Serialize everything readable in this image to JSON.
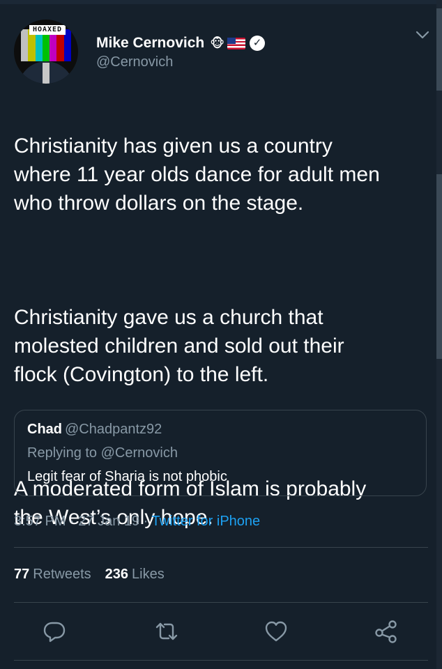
{
  "tweet": {
    "author": {
      "display_name": "Mike Cernovich",
      "handle": "@Cernovich",
      "avatar_label": "HOAXED",
      "emoji_1": "🐵",
      "verified_glyph": "✓"
    },
    "paragraph_1": "Christianity has given us a country\nwhere 11 year olds dance for adult men\nwho throw dollars on the stage.",
    "paragraph_2": "Christianity gave us a church that\nmolested children and sold out their\nflock (Covington) to the left.",
    "paragraph_3": "A moderated form of Islam is probably\nthe West’s only hope.",
    "quoted": {
      "name": "Chad",
      "handle": "@Chadpantz92",
      "replying_to": "Replying to @Cernovich",
      "body": "Legit fear of Sharia is not phobic"
    },
    "time": "3:57 PM",
    "date": "27 Jan 19",
    "separator": " · ",
    "source": "Twitter for iPhone",
    "retweets_count": "77",
    "retweets_label": "Retweets",
    "likes_count": "236",
    "likes_label": "Likes"
  },
  "icons": {
    "more": "chevron-down-icon",
    "reply": "reply-icon",
    "retweet": "retweet-icon",
    "like": "heart-icon",
    "share": "share-icon"
  },
  "colors": {
    "background": "#15202b",
    "text": "#ffffff",
    "secondary": "#8899a6",
    "link": "#1da1f2",
    "border": "#38444d"
  }
}
